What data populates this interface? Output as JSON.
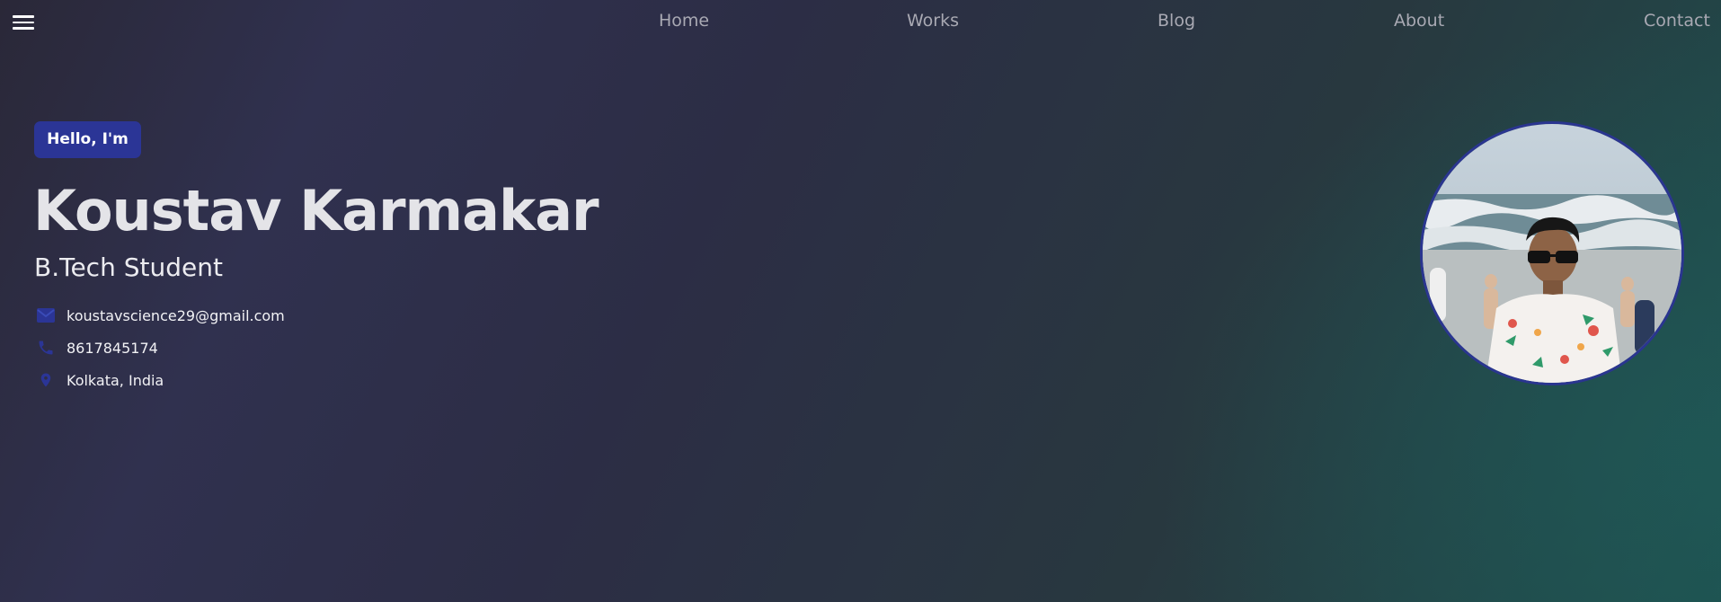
{
  "header": {
    "menu_icon": "hamburger-menu-icon",
    "nav": [
      {
        "label": "Home"
      },
      {
        "label": "Works"
      },
      {
        "label": "Blog"
      },
      {
        "label": "About"
      },
      {
        "label": "Contact"
      }
    ]
  },
  "hero": {
    "greeting": "Hello, I'm",
    "name": "Koustav Karmakar",
    "role": "B.Tech Student",
    "contacts": [
      {
        "icon": "email-icon",
        "text": "koustavscience29@gmail.com"
      },
      {
        "icon": "phone-icon",
        "text": "8617845174"
      },
      {
        "icon": "location-pin-icon",
        "text": "Kolkata, India"
      }
    ]
  },
  "colors": {
    "accent": "#2b3596",
    "nav_text": "#a9a9b3",
    "name_text": "#e4e4e8"
  }
}
